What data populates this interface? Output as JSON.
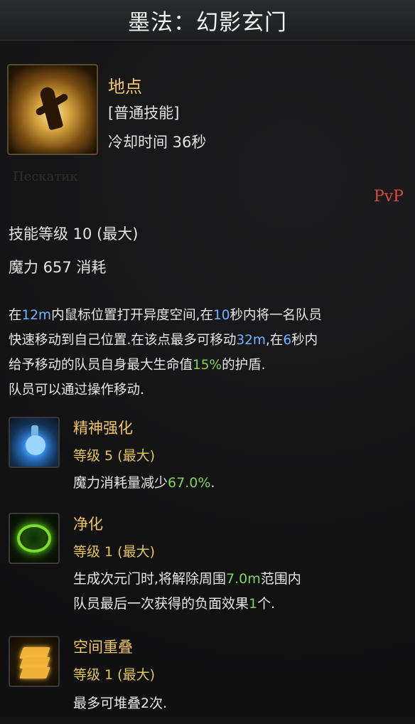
{
  "header": {
    "title": "墨法：幻影玄门"
  },
  "skill": {
    "name": "地点",
    "type": "[普通技能]",
    "cooldown": "冷却时间 36秒",
    "watermark": "Пескатик",
    "pvp_tag": "PvP",
    "level_text": "技能等级 10 (最大)",
    "mana_text": "魔力 657 消耗"
  },
  "description": {
    "parts": [
      "在",
      "12m",
      "内鼠标位置打开异度空间,在",
      "10",
      "秒内将一名队员",
      "快速移动到自己位置.在该点最多可移动",
      "32m",
      ",在",
      "6",
      "秒内",
      "给予移动的队员自身最大生命值",
      "15%",
      "的护盾.",
      "队员可以通过操作移动."
    ]
  },
  "tripods": [
    {
      "icon": "flask-icon",
      "name": "精神强化",
      "level": "等级 5 (最大)",
      "desc_a": "魔力消耗量减少",
      "desc_hl": "67.0%",
      "desc_b": "."
    },
    {
      "icon": "purify-ring-icon",
      "name": "净化",
      "level": "等级 1 (最大)",
      "line1_a": "生成次元门时,将解除周围",
      "line1_hl": "7.0m",
      "line1_b": "范围内",
      "line2_a": "队员最后一次获得的负面效果",
      "line2_hl": "1",
      "line2_b": "个."
    },
    {
      "icon": "stacked-layers-icon",
      "name": "空间重叠",
      "level": "等级 1 (最大)",
      "desc": "最多可堆叠2次."
    }
  ],
  "colors": {
    "gold": "#f2c46a",
    "blue_highlight": "#6fb3ff",
    "green_highlight": "#7fd35a",
    "pvp_red": "#d94b40"
  }
}
